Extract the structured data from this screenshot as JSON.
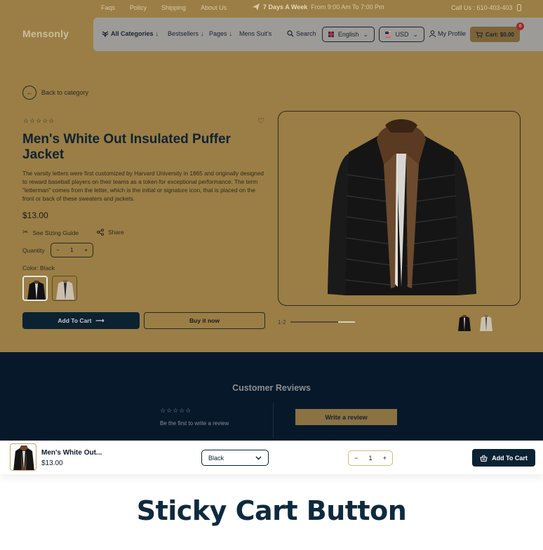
{
  "topbar": {
    "links": [
      "Faqs",
      "Policy",
      "Shipping",
      "About Us"
    ],
    "promo_bold": "7 Days A Week",
    "promo_text": "From 9:00 Am To 7:00 Pm",
    "call": "Call Us : 610-403-403"
  },
  "header": {
    "logo": "Mensonly",
    "all_categories": "All Categories",
    "nav": [
      "Bestsellers",
      "Pages",
      "Mens Suit's"
    ],
    "search": "Search",
    "language": "English",
    "currency": "USD",
    "profile": "My Profile",
    "cart": "Cart: $0.00",
    "cart_count": "0"
  },
  "product": {
    "back": "Back to category",
    "rating_stars": "☆☆☆☆☆",
    "title": "Men's White Out Insulated Puffer Jacket",
    "description": "The varsity letters were first customized by Harvard University in 1865 and originally designed to reward baseball players on their teams as a token for exceptional performance. The term \"letterman\" comes from the letter, which is the initial or signature icon, that is placed on the front or back of these sweaters and jackets.",
    "price": "$13.00",
    "sizing_guide": "See Sizing Guide",
    "share": "Share",
    "quantity_label": "Quantity",
    "quantity": "1",
    "color_label": "Color: Black",
    "add_to_cart": "Add To Cart",
    "buy_now": "Buy it now",
    "slide_counter": "1-2",
    "slide_progress": 0.26
  },
  "reviews": {
    "title": "Customer Reviews",
    "stars": "☆☆☆☆☆",
    "note": "Be the first to write a review",
    "write_button": "Write a review"
  },
  "sticky": {
    "name": "Men's White Out...",
    "price": "$13.00",
    "variant": "Black",
    "quantity": "1",
    "add_to_cart": "Add To Cart"
  },
  "caption": "Sticky Cart Button",
  "colors": {
    "gold_overlay": "#9a7e45",
    "navy": "#0b2233",
    "review_bg": "#07182a",
    "accent": "#d8b87f"
  }
}
